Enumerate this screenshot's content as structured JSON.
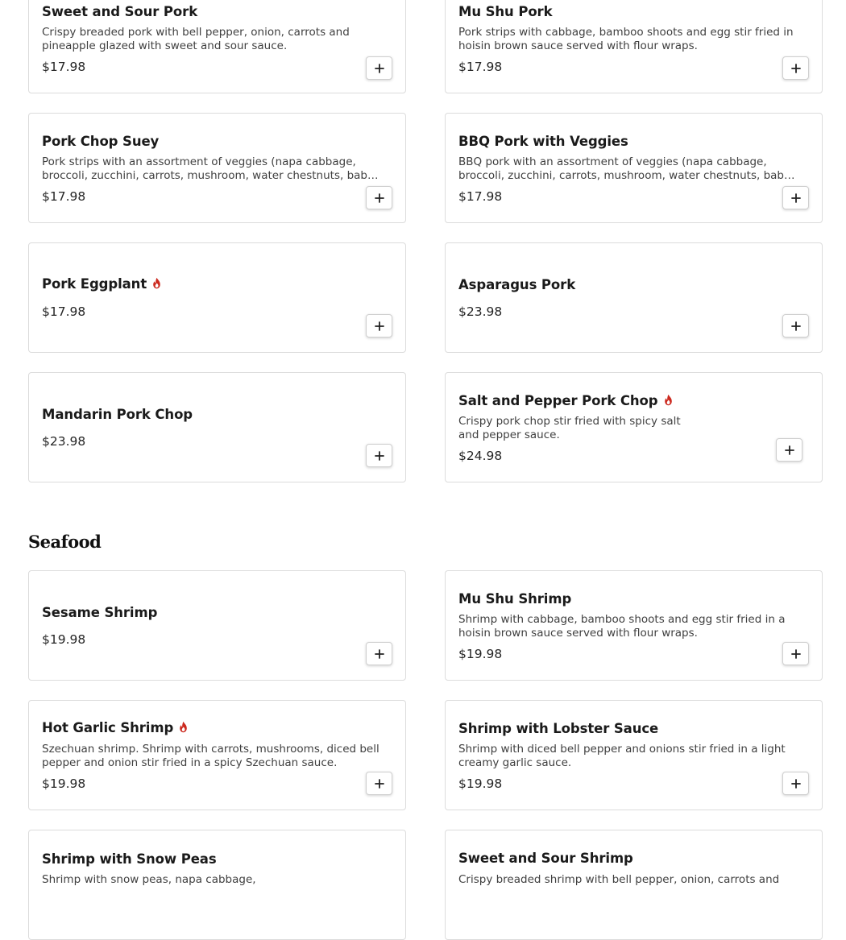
{
  "pork_items": [
    {
      "name": "Sweet and Sour Pork",
      "description": "Crispy breaded pork with bell pepper, onion, carrots and pineapple glazed with sweet and sour sauce.",
      "price": "$17.98",
      "spicy": false
    },
    {
      "name": "Mu Shu Pork",
      "description": "Pork strips with cabbage, bamboo shoots and egg stir fried in hoisin brown sauce served with flour wraps.",
      "price": "$17.98",
      "spicy": false
    },
    {
      "name": "Pork Chop Suey",
      "description": "Pork strips with an assortment of veggies (napa cabbage, broccoli, zucchini, carrots, mushroom, water chestnuts, bab…",
      "price": "$17.98",
      "spicy": false
    },
    {
      "name": "BBQ Pork with Veggies",
      "description": "BBQ pork with an assortment of veggies (napa cabbage, broccoli, zucchini, carrots, mushroom, water chestnuts, bab…",
      "price": "$17.98",
      "spicy": false
    },
    {
      "name": "Pork Eggplant",
      "description": "",
      "price": "$17.98",
      "spicy": true
    },
    {
      "name": "Asparagus Pork",
      "description": "",
      "price": "$23.98",
      "spicy": false
    },
    {
      "name": "Mandarin Pork Chop",
      "description": "",
      "price": "$23.98",
      "spicy": false
    },
    {
      "name": "Salt and Pepper Pork Chop",
      "description": "Crispy pork chop stir fried with spicy salt and pepper sauce.",
      "price": "$24.98",
      "spicy": true
    }
  ],
  "seafood_section": {
    "title": "Seafood",
    "items": [
      {
        "name": "Sesame Shrimp",
        "description": "",
        "price": "$19.98",
        "spicy": false
      },
      {
        "name": "Mu Shu Shrimp",
        "description": "Shrimp with cabbage, bamboo shoots and egg stir fried in a hoisin brown sauce served with flour wraps.",
        "price": "$19.98",
        "spicy": false
      },
      {
        "name": "Hot Garlic Shrimp",
        "description": "Szechuan shrimp. Shrimp with carrots, mushrooms, diced bell pepper and onion stir fried in a spicy Szechuan sauce.",
        "price": "$19.98",
        "spicy": true
      },
      {
        "name": "Shrimp with Lobster Sauce",
        "description": "Shrimp with diced bell pepper and onions stir fried in a light creamy garlic sauce.",
        "price": "$19.98",
        "spicy": false
      },
      {
        "name": "Shrimp with Snow Peas",
        "description": "Shrimp with snow peas, napa cabbage,",
        "price": "",
        "spicy": false
      },
      {
        "name": "Sweet and Sour Shrimp",
        "description": "Crispy breaded shrimp with bell pepper, onion, carrots and",
        "price": "",
        "spicy": false
      }
    ]
  },
  "icons": {
    "add": "plus-icon",
    "spicy": "chili-flame-icon"
  },
  "colors": {
    "spicy": "#cc2a1f",
    "card_border": "#dcdcdc"
  }
}
